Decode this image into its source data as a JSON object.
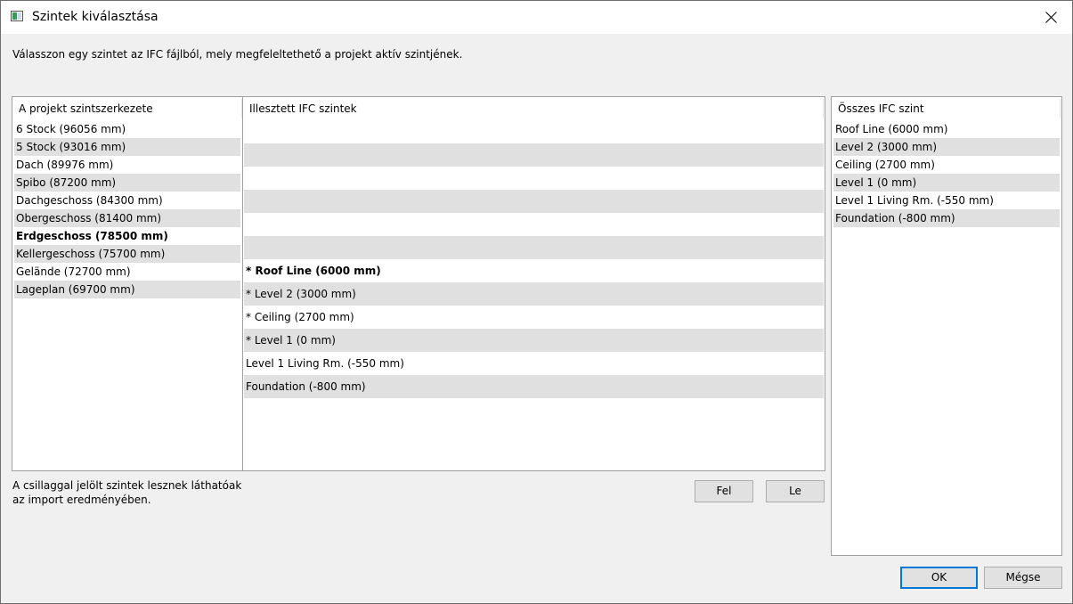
{
  "window": {
    "title": "Szintek kiválasztása"
  },
  "instruction": "Válasszon egy szintet az IFC fájlból, mely megfeleltethető a projekt aktív szintjének.",
  "project_panel": {
    "header": "A projekt szintszerkezete",
    "items": [
      {
        "label": "6 Stock (96056 mm)",
        "bold": false
      },
      {
        "label": "5 Stock (93016 mm)",
        "bold": false
      },
      {
        "label": "Dach (89976 mm)",
        "bold": false
      },
      {
        "label": "Spibo (87200 mm)",
        "bold": false
      },
      {
        "label": "Dachgeschoss (84300 mm)",
        "bold": false
      },
      {
        "label": "Obergeschoss (81400 mm)",
        "bold": false
      },
      {
        "label": "Erdgeschoss (78500 mm)",
        "bold": true
      },
      {
        "label": "Kellergeschoss (75700 mm)",
        "bold": false
      },
      {
        "label": "Gelände (72700 mm)",
        "bold": false
      },
      {
        "label": "Lageplan (69700 mm)",
        "bold": false
      }
    ]
  },
  "matched_panel": {
    "header": "Illesztett IFC szintek",
    "items": [
      {
        "label": "",
        "bold": false
      },
      {
        "label": "",
        "bold": false
      },
      {
        "label": "",
        "bold": false
      },
      {
        "label": "",
        "bold": false
      },
      {
        "label": "",
        "bold": false
      },
      {
        "label": "",
        "bold": false
      },
      {
        "label": "* Roof Line (6000 mm)",
        "bold": true
      },
      {
        "label": "* Level 2 (3000 mm)",
        "bold": false
      },
      {
        "label": "* Ceiling (2700 mm)",
        "bold": false
      },
      {
        "label": "* Level 1 (0 mm)",
        "bold": false
      },
      {
        "label": "Level 1 Living Rm. (-550 mm)",
        "bold": false
      },
      {
        "label": "Foundation (-800 mm)",
        "bold": false
      }
    ]
  },
  "all_ifc_panel": {
    "header": "Összes IFC szint",
    "items": [
      {
        "label": "Roof Line (6000 mm)"
      },
      {
        "label": "Level 2 (3000 mm)"
      },
      {
        "label": "Ceiling (2700 mm)"
      },
      {
        "label": "Level 1 (0 mm)"
      },
      {
        "label": "Level 1 Living Rm. (-550 mm)"
      },
      {
        "label": "Foundation (-800 mm)"
      }
    ]
  },
  "note": {
    "line1": "A csillaggal jelölt szintek lesznek láthatóak",
    "line2": "az import eredményében."
  },
  "buttons": {
    "up": "Fel",
    "down": "Le",
    "ok": "OK",
    "cancel": "Mégse"
  },
  "colors": {
    "alt_row": "#e0e0e0",
    "default_button_border": "#0078d7"
  },
  "icons": {
    "app": "app-window-icon",
    "close": "close-icon"
  }
}
